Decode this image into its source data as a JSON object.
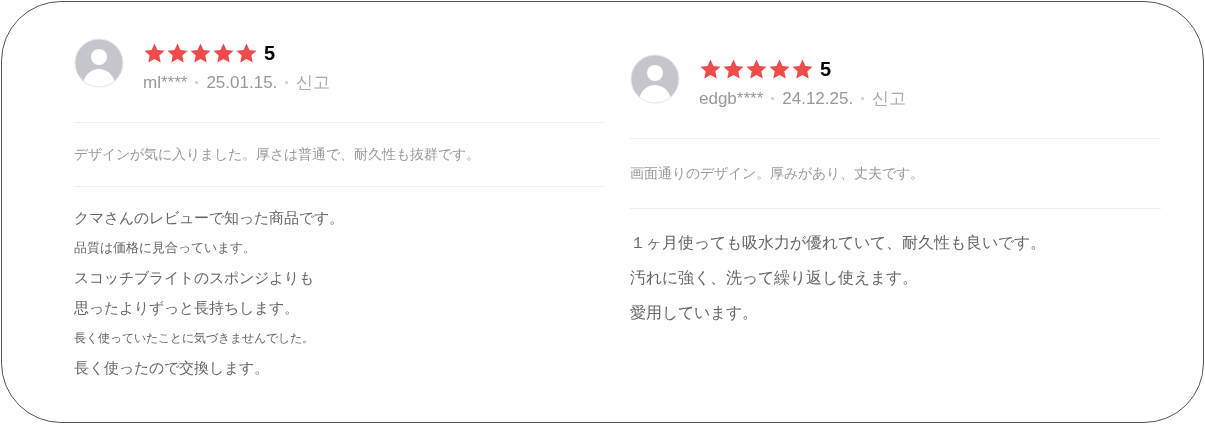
{
  "reviews": [
    {
      "stars": 5,
      "score": "5",
      "user": "ml****",
      "date": "25.01.15.",
      "report": "신고",
      "summary": "デザインが気に入りました。厚さは普通で、耐久性も抜群です。",
      "body": [
        {
          "text": "クマさんのレビューで知った商品です。",
          "kind": "normal"
        },
        {
          "text": "品質は価格に見合っています。",
          "kind": "small"
        },
        {
          "text": "スコッチブライトのスポンジよりも",
          "kind": "normal"
        },
        {
          "text": "思ったよりずっと長持ちします。",
          "kind": "normal"
        },
        {
          "text": "長く使っていたことに気づきませんでした。",
          "kind": "tiny"
        },
        {
          "text": "長く使ったので交換します。",
          "kind": "normal"
        }
      ]
    },
    {
      "stars": 5,
      "score": "5",
      "user": "edgb****",
      "date": "24.12.25.",
      "report": "신고",
      "summary": "画面通りのデザイン。厚みがあり、丈夫です。",
      "body": [
        {
          "text": "１ヶ月使っても吸水力が優れていて、耐久性も良いです。",
          "kind": "large"
        },
        {
          "text": "汚れに強く、洗って繰り返し使えます。",
          "kind": "large"
        },
        {
          "text": "愛用しています。",
          "kind": "large"
        }
      ]
    }
  ]
}
